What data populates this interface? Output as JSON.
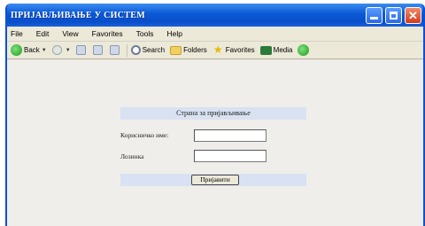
{
  "window": {
    "title": "ПРИЈАВЉИВАЊЕ У СИСТЕМ"
  },
  "menu": {
    "items": [
      "File",
      "Edit",
      "View",
      "Favorites",
      "Tools",
      "Help"
    ]
  },
  "toolbar": {
    "back": "Back",
    "search": "Search",
    "folders": "Folders",
    "favorites": "Favorites",
    "media": "Media"
  },
  "form": {
    "header": "Страна за пријављивање",
    "username_label": "Корисничко име:",
    "username_value": "",
    "password_label": "Лозинка",
    "password_value": "",
    "submit_label": "Пријавити"
  },
  "colors": {
    "titlebar": "#0a58d6",
    "panel_band": "#d8e2f2",
    "close_button": "#d83a1a"
  }
}
